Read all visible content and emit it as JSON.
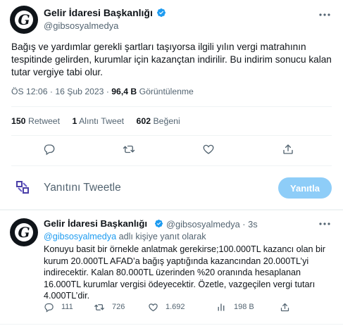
{
  "main_tweet": {
    "display_name": "Gelir İdaresi Başkanlığı",
    "handle": "@gibsosyalmedya",
    "text": "Bağış ve yardımlar gerekli şartları taşıyorsa ilgili yılın vergi matrahının tespitinde gelirden, kurumlar için kazançtan indirilir. Bu indirim sonucu kalan tutar vergiye tabi olur.",
    "time_date": "ÖS 12:06 · 16 Şub 2023 · ",
    "views_value": "96,4 B",
    "views_label": " Görüntülenme",
    "retweets_value": "150",
    "retweets_label": " Retweet",
    "quotes_value": "1",
    "quotes_label": " Alıntı Tweet",
    "likes_value": "602",
    "likes_label": " Beğeni"
  },
  "reply_box": {
    "placeholder": "Yanıtını Tweetle",
    "button_label": "Yanıtla"
  },
  "reply_tweet": {
    "display_name": "Gelir İdaresi Başkanlığı",
    "handle_time": "@gibsosyalmedya · 3s",
    "reply_to_handle": "@gibsosyalmedya",
    "reply_to_suffix": " adlı kişiye yanıt olarak",
    "text": "Konuyu basit bir örnekle anlatmak gerekirse;100.000TL kazancı olan bir kurum 20.000TL AFAD’a bağış yaptığında kazancından 20.000TL’yi indirecektir. Kalan 80.000TL üzerinden %20 oranında hesaplanan 16.000TL kurumlar vergisi ödeyecektir. Özetle, vazgeçilen vergi tutarı 4.000TL’dir.",
    "reply_count": "111",
    "retweet_count": "726",
    "like_count": "1.692",
    "view_count": "198 B"
  },
  "colors": {
    "accent": "#1d9bf0",
    "button_disabled": "#8ecdf8",
    "secondary_text": "#536471",
    "divider": "#eff3f4"
  },
  "icons": [
    "verified-badge-icon",
    "more-icon",
    "reply-icon",
    "retweet-icon",
    "like-icon",
    "share-icon",
    "views-icon",
    "brand-logo-icon"
  ]
}
